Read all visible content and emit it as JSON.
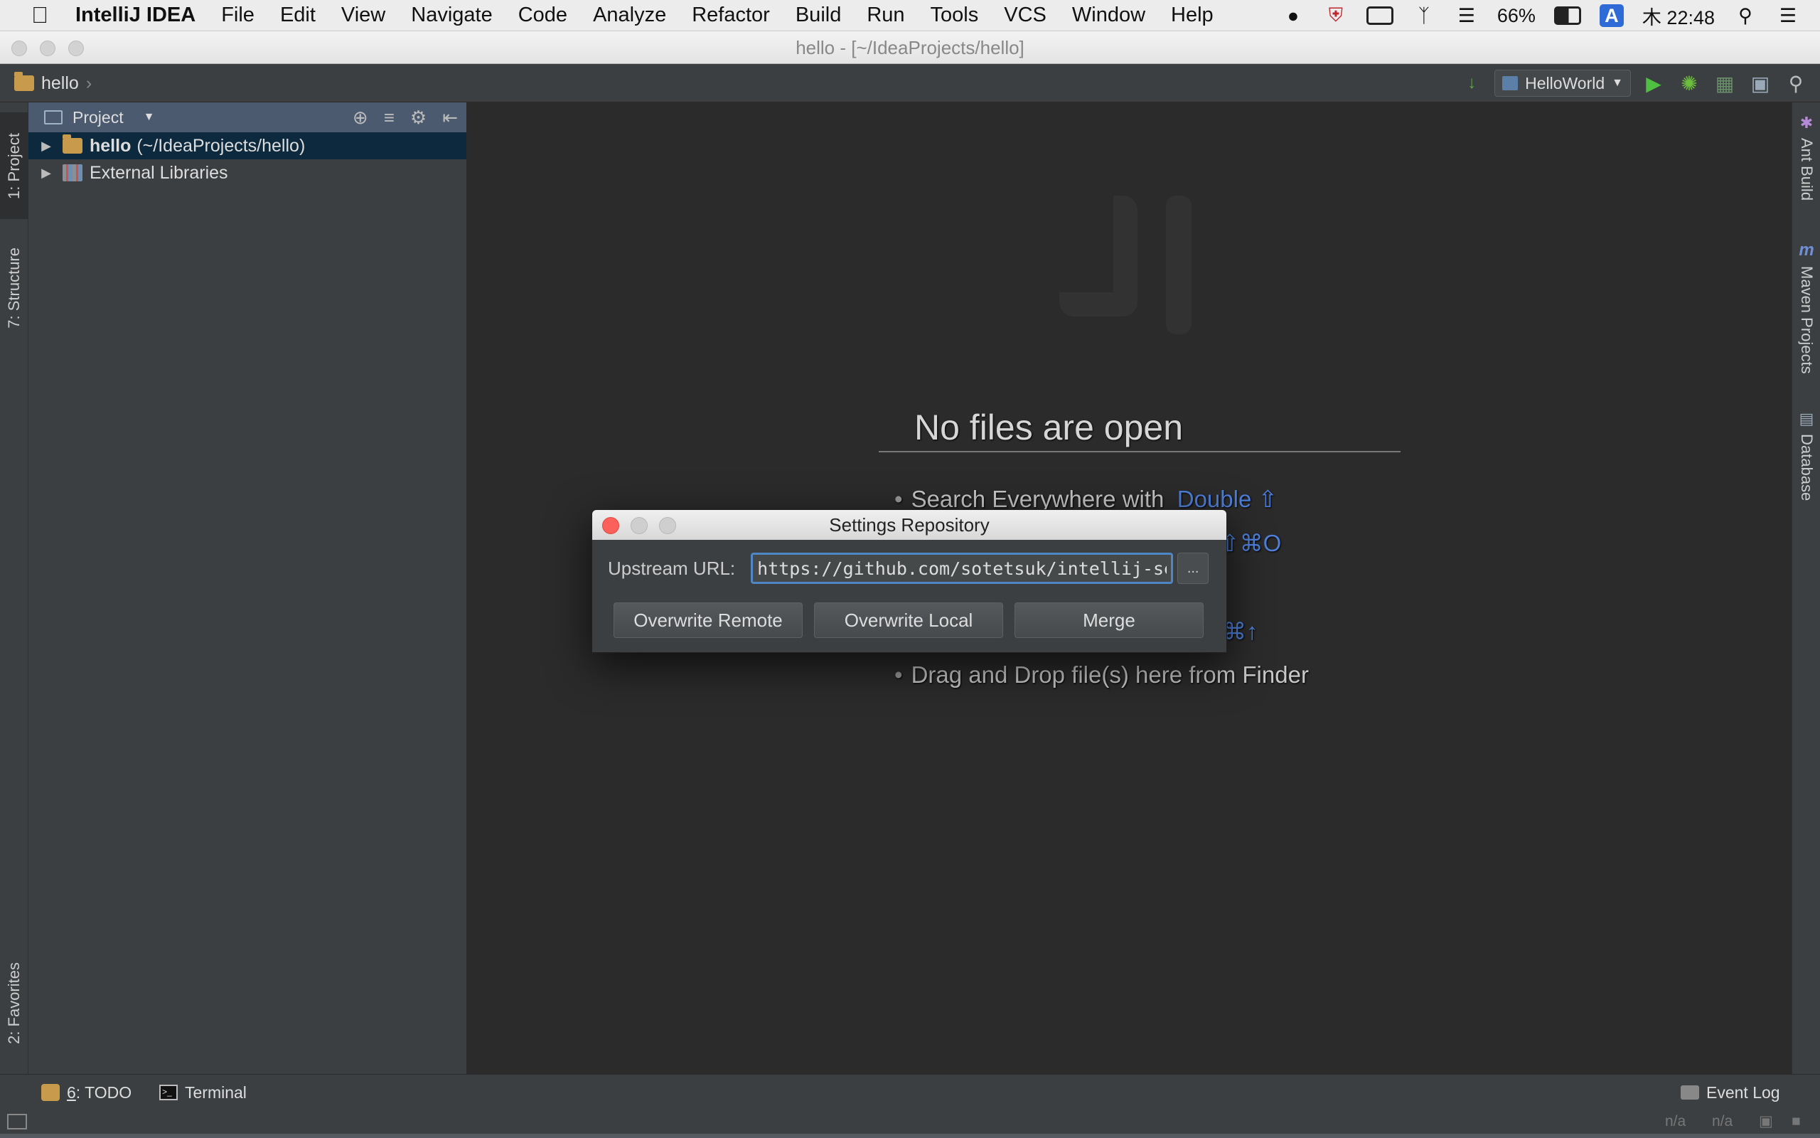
{
  "menubar": {
    "app_name": "IntelliJ IDEA",
    "menus": [
      "File",
      "Edit",
      "View",
      "Navigate",
      "Code",
      "Analyze",
      "Refactor",
      "Build",
      "Run",
      "Tools",
      "VCS",
      "Window",
      "Help"
    ],
    "battery": "66%",
    "input_source": "A",
    "clock": "木 22:48"
  },
  "window": {
    "title": "hello - [~/IdeaProjects/hello]"
  },
  "navbar": {
    "breadcrumb": "hello",
    "run_config": "HelloWorld"
  },
  "left_stripe": {
    "project_tab": "1: Project",
    "structure_tab": "7: Structure",
    "favorites_tab": "2: Favorites"
  },
  "right_stripe": {
    "ant_tab": "Ant Build",
    "maven_tab": "Maven Projects",
    "database_tab": "Database"
  },
  "project_panel": {
    "title": "Project",
    "tree": [
      {
        "name": "hello",
        "path": "(~/IdeaProjects/hello)"
      },
      {
        "name": "External Libraries"
      }
    ]
  },
  "editor": {
    "empty_title": "No files are open",
    "hints": [
      {
        "text": "Search Everywhere with",
        "key": "Double ⇧"
      },
      {
        "text": "",
        "key": "⇧⌘O"
      },
      {
        "text": "",
        "key": "⌘↑"
      },
      {
        "text": "Drag and Drop file(s) here from Finder",
        "key": ""
      }
    ]
  },
  "dialog": {
    "title": "Settings Repository",
    "url_label": "Upstream URL:",
    "url_value": "https://github.com/sotetsuk/intellij-setting",
    "browse": "...",
    "buttons": {
      "overwrite_remote": "Overwrite Remote",
      "overwrite_local": "Overwrite Local",
      "merge": "Merge"
    }
  },
  "bottom_bar": {
    "todo_num": "6",
    "todo_label": ": TODO",
    "terminal": "Terminal",
    "event_log": "Event Log"
  },
  "status_bar": {
    "pos1": "n/a",
    "pos2": "n/a"
  }
}
